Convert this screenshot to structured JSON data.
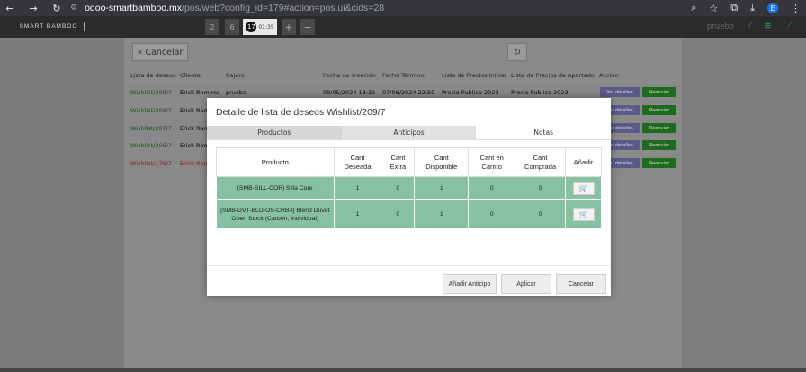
{
  "browser": {
    "url_host": "odoo-smartbamboo.mx",
    "url_path": "/pos/web?config_id=179#action=pos.ui&cids=28",
    "profile_initial": "E"
  },
  "pos": {
    "logo": "SMART BAMBOO",
    "order_tabs": [
      "2",
      "6"
    ],
    "active_order": {
      "number": "17",
      "time": "01:35"
    },
    "user": "pruebo",
    "help": "?"
  },
  "list": {
    "cancel_label": "« Cancelar",
    "headers": [
      "Lista de deseos",
      "Cliente",
      "Cajero",
      "Fecha de creación",
      "Fecha Término",
      "Lista de Precios Inicial",
      "Lista de Precios de Apartado",
      "Acción"
    ],
    "rows": [
      {
        "wishlist": "Wishlist/209/7",
        "client": "Erick Ramirez",
        "cashier": "prueba",
        "created": "09/05/2024 13:32",
        "end": "07/06/2024 22:59",
        "price_initial": "Precio Publico 2023",
        "price_layaway": "Precio Publico 2023",
        "red": false
      },
      {
        "wishlist": "Wishlist/208/7",
        "client": "Erick Ram",
        "cashier": "",
        "created": "",
        "end": "",
        "price_initial": "",
        "price_layaway": "",
        "red": false
      },
      {
        "wishlist": "Wishlist/207/7",
        "client": "Erick Ram",
        "cashier": "",
        "created": "",
        "end": "",
        "price_initial": "",
        "price_layaway": "",
        "red": false
      },
      {
        "wishlist": "Wishlist/206/7",
        "client": "Erick Ram",
        "cashier": "",
        "created": "",
        "end": "",
        "price_initial": "",
        "price_layaway": "",
        "red": false
      },
      {
        "wishlist": "Wishlist/176/7",
        "client": "Erick Ram",
        "cashier": "",
        "created": "",
        "end": "",
        "price_initial": "",
        "price_layaway": "",
        "red": true
      }
    ],
    "btn_details": "Ver detalles",
    "btn_send": "Reenviar"
  },
  "modal": {
    "title": "Detalle de lista de deseos Wishlist/209/7",
    "tabs": [
      "Productos",
      "Anticipos",
      "Notas"
    ],
    "columns": {
      "product": "Producto",
      "desired": [
        "Cant",
        "Deseada"
      ],
      "extra": [
        "Cant",
        "Extra"
      ],
      "available": [
        "Cant",
        "Disponible"
      ],
      "cart": [
        "Cant en",
        "Carrito"
      ],
      "bought": [
        "Cant",
        "Comprada"
      ],
      "add": "Añadir"
    },
    "products": [
      {
        "name": "[SMB-SILL-COR] Silla Core",
        "desired": "1",
        "extra": "0",
        "available": "1",
        "cart": "0",
        "bought": "0"
      },
      {
        "name": "[SMB-DVT-BLD-OS-CRB-I] Blend Duvet Open Stock (Carbon, Individual)",
        "desired": "1",
        "extra": "0",
        "available": "1",
        "cart": "0",
        "bought": "0"
      }
    ],
    "buttons": {
      "advance": "Añadir Anticipo",
      "apply": "Aplicar",
      "cancel": "Cancelar"
    }
  }
}
